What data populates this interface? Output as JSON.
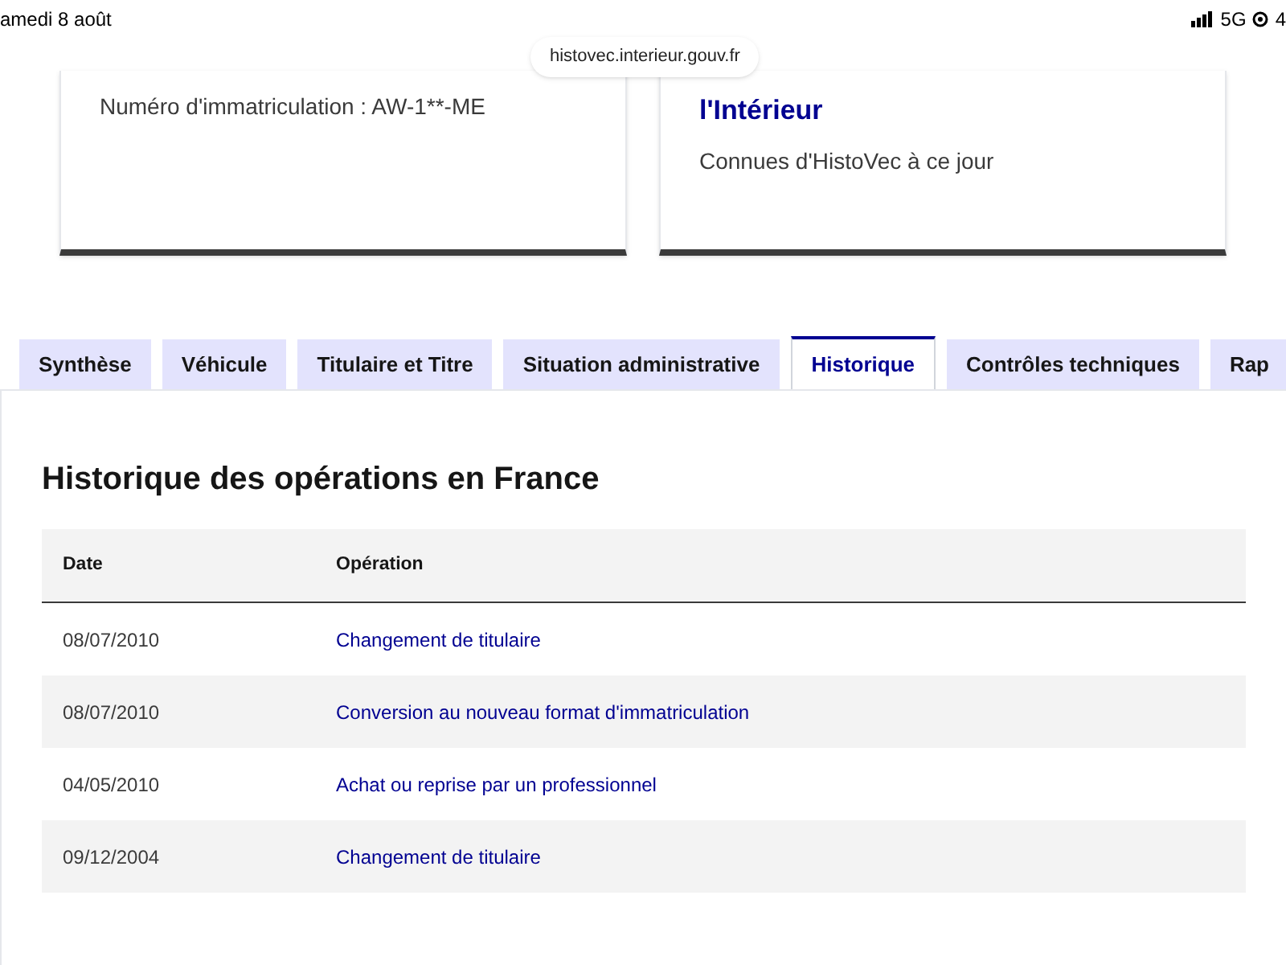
{
  "status_bar": {
    "date": "amedi 8 août",
    "network": "5G",
    "battery": "4"
  },
  "address_bar": {
    "url": "histovec.interieur.gouv.fr"
  },
  "cards": [
    {
      "kind": "text",
      "text": "Numéro d'immatriculation : AW-1**-ME"
    },
    {
      "kind": "titled",
      "title": "l'Intérieur",
      "text": "Connues d'HistoVec à ce jour"
    }
  ],
  "tabs": [
    {
      "label": "Synthèse",
      "selected": false
    },
    {
      "label": "Véhicule",
      "selected": false
    },
    {
      "label": "Titulaire et Titre",
      "selected": false
    },
    {
      "label": "Situation administrative",
      "selected": false
    },
    {
      "label": "Historique",
      "selected": true
    },
    {
      "label": "Contrôles techniques",
      "selected": false
    },
    {
      "label": "Rap",
      "selected": false
    }
  ],
  "section": {
    "title": "Historique des opérations en France",
    "table": {
      "columns": [
        "Date",
        "Opération"
      ],
      "rows": [
        [
          "08/07/2010",
          "Changement de titulaire"
        ],
        [
          "08/07/2010",
          "Conversion au nouveau format d'immatriculation"
        ],
        [
          "04/05/2010",
          "Achat ou reprise par un professionnel"
        ],
        [
          "09/12/2004",
          "Changement de titulaire"
        ]
      ]
    }
  }
}
